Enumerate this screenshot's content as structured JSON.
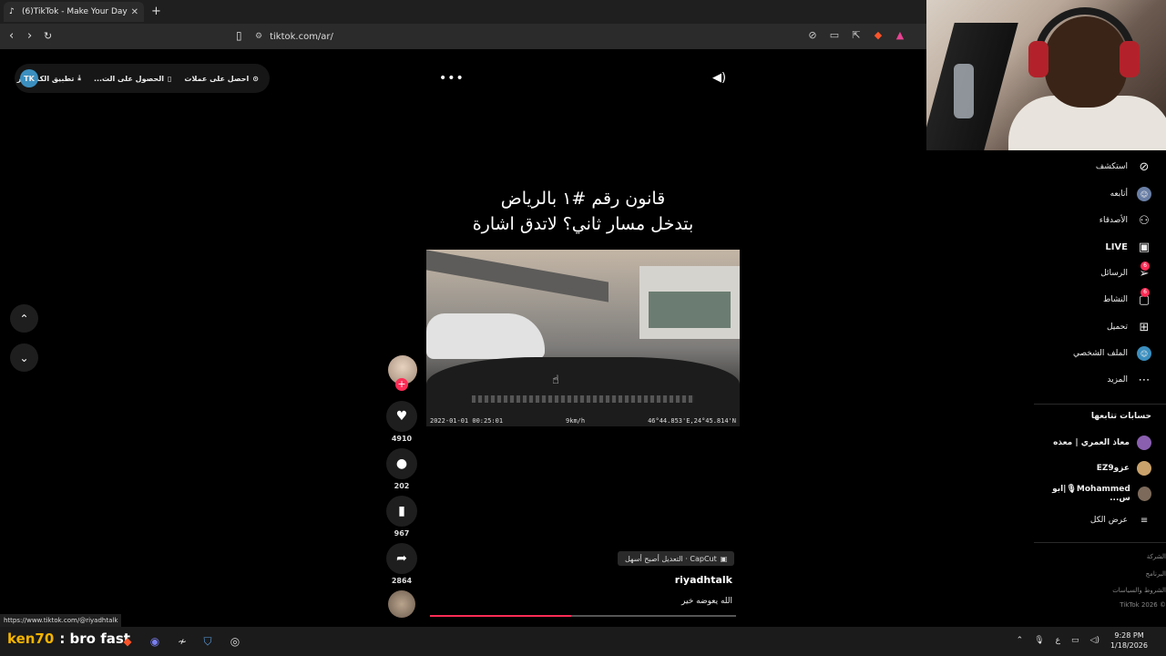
{
  "browser": {
    "tab_title": "(6)TikTok - Make Your Day",
    "url": "tiktok.com/ar/",
    "new_tab": "+",
    "tab_close": "✕"
  },
  "top_pill": {
    "get_coins": "احصل على عملات",
    "get_app": "الحصول على الت...",
    "desktop_app": "تطبيق الكمبيوتر",
    "avatar_text": "TK"
  },
  "video": {
    "overlay_caption_line1": "قانون رقم #١ بالرياض",
    "overlay_caption_line2": "بتدخل مسار ثاني؟ لاتدق اشارة",
    "timestamp": "2022-01-01 00:25:01",
    "speed": "9km/h",
    "gps": "46°44.853'E,24°45.814'N",
    "progress": 0.46
  },
  "actions": {
    "likes": "4910",
    "comments": "202",
    "saves": "967",
    "shares": "2864",
    "follow_plus": "+"
  },
  "post": {
    "capcut_label": "CapCut · التعديل أصبح أسهل",
    "username": "riyadhtalk",
    "description": "الله يعوضه خير"
  },
  "sidebar": {
    "explore": "استكشف",
    "foryou": "أتابعه",
    "friends": "الأصدقاء",
    "live": "LIVE",
    "messages": "الرسائل",
    "messages_badge": "6",
    "activity": "النشاط",
    "activity_badge": "6",
    "upload": "تحميل",
    "profile": "الملف الشخصي",
    "more": "المزيد",
    "following_heading": "حسابات تتابعها",
    "following": [
      {
        "name": "معاذ العمري | معذه"
      },
      {
        "name": "عزوEZ9"
      },
      {
        "name": "Mohammed🎙|ابو س..."
      }
    ],
    "see_all": "عرض الكل",
    "footer": [
      "الشركة",
      "البرنامج",
      "الشروط والسياسات",
      "© TikTok 2026"
    ]
  },
  "status_url": "https://www.tiktok.com/@riyadhtalk",
  "taskbar": {
    "overlay_name": "ken70",
    "overlay_msg": ": bro fast",
    "time": "9:28 PM",
    "date": "1/18/2026",
    "lang": "ع"
  },
  "colors": {
    "accent": "#fe2c55",
    "background": "#000000"
  }
}
